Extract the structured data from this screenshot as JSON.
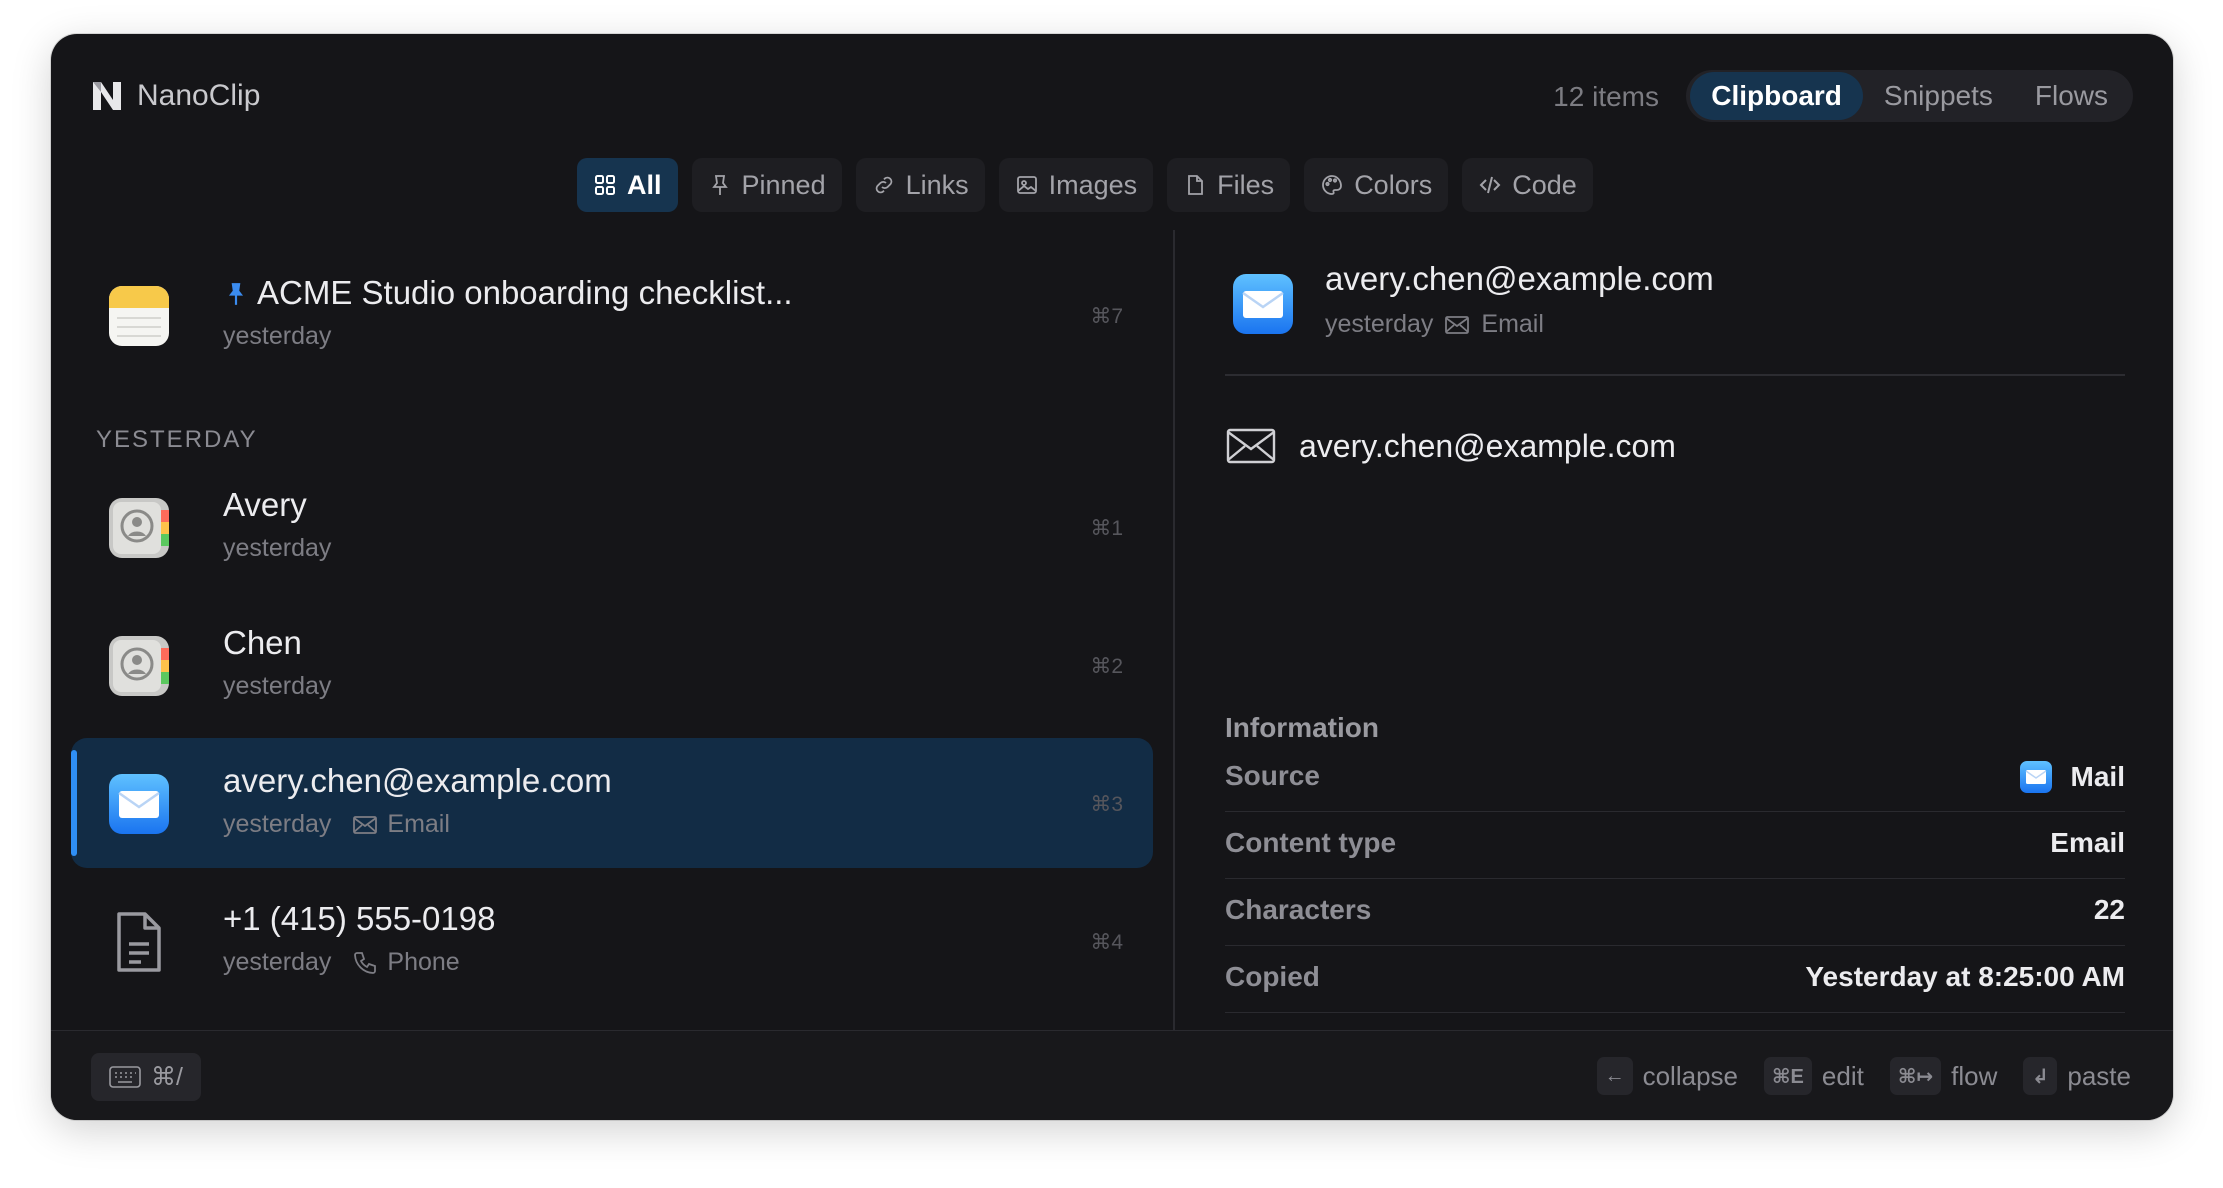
{
  "app": {
    "title": "NanoClip",
    "item_count": "12 items"
  },
  "mode_tabs": [
    {
      "label": "Clipboard",
      "active": true
    },
    {
      "label": "Snippets",
      "active": false
    },
    {
      "label": "Flows",
      "active": false
    }
  ],
  "filters": [
    {
      "label": "All",
      "icon": "grid-icon",
      "active": true
    },
    {
      "label": "Pinned",
      "icon": "pin-icon",
      "active": false
    },
    {
      "label": "Links",
      "icon": "link-icon",
      "active": false
    },
    {
      "label": "Images",
      "icon": "image-icon",
      "active": false
    },
    {
      "label": "Files",
      "icon": "file-icon",
      "active": false
    },
    {
      "label": "Colors",
      "icon": "palette-icon",
      "active": false
    },
    {
      "label": "Code",
      "icon": "code-icon",
      "active": false
    }
  ],
  "list": {
    "section_label": "YESTERDAY",
    "items": [
      {
        "title": "ACME Studio onboarding checklist...",
        "time": "yesterday",
        "shortcut": "⌘7",
        "icon": "notes-app-icon",
        "pinned": true
      },
      {
        "title": "Avery",
        "time": "yesterday",
        "shortcut": "⌘1",
        "icon": "contacts-app-icon"
      },
      {
        "title": "Chen",
        "time": "yesterday",
        "shortcut": "⌘2",
        "icon": "contacts-app-icon"
      },
      {
        "title": "avery.chen@example.com",
        "time": "yesterday",
        "tag": "Email",
        "shortcut": "⌘3",
        "icon": "mail-app-icon",
        "selected": true
      },
      {
        "title": "+1 (415) 555-0198",
        "time": "yesterday",
        "tag": "Phone",
        "shortcut": "⌘4",
        "icon": "document-icon"
      }
    ]
  },
  "detail": {
    "title": "avery.chen@example.com",
    "time": "yesterday",
    "tag": "Email",
    "content": "avery.chen@example.com",
    "info_title": "Information",
    "info": [
      {
        "key": "Source",
        "value": "Mail"
      },
      {
        "key": "Content type",
        "value": "Email"
      },
      {
        "key": "Characters",
        "value": "22"
      },
      {
        "key": "Copied",
        "value": "Yesterday at 8:25:00 AM"
      }
    ]
  },
  "footer": {
    "shortcut_button": "⌘/",
    "hints": [
      {
        "key": "←",
        "label": "collapse"
      },
      {
        "key": "⌘E",
        "label": "edit"
      },
      {
        "key": "⌘↦",
        "label": "flow"
      },
      {
        "key": "↲",
        "label": "paste"
      }
    ]
  },
  "colors": {
    "accent": "#2f8ff5",
    "selected_bg": "#122c45",
    "window_bg": "#151518"
  }
}
